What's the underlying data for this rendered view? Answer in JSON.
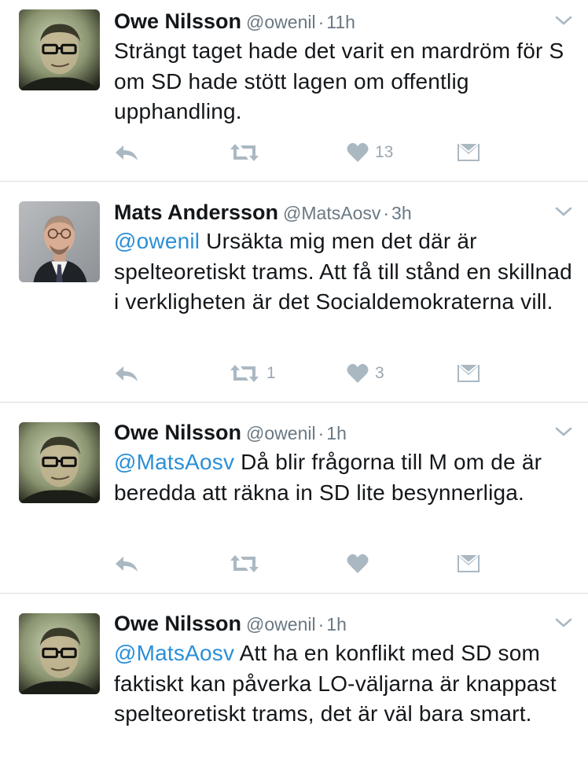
{
  "tweets": [
    {
      "name": "Owe Nilsson",
      "handle": "@owenil",
      "separator": "·",
      "time": "11h",
      "mention": "",
      "text": "Strängt taget hade det varit en mardröm för S om SD hade stött lagen om offentlig upphandling.",
      "retweets": "",
      "likes": "13",
      "avatar": "owe-nilsson-photo"
    },
    {
      "name": "Mats Andersson",
      "handle": "@MatsAosv",
      "separator": "·",
      "time": "3h",
      "mention": "@owenil",
      "text": " Ursäkta mig men det där är spelteoretiskt trams. Att få till stånd en skillnad i verkligheten är det Socialdemokraterna vill.",
      "retweets": "1",
      "likes": "3",
      "avatar": "mats-andersson-photo"
    },
    {
      "name": "Owe Nilsson",
      "handle": "@owenil",
      "separator": "·",
      "time": "1h",
      "mention": "@MatsAosv",
      "text": " Då blir frågorna till M om de är beredda att räkna in SD lite besynnerliga.",
      "retweets": "",
      "likes": "",
      "avatar": "owe-nilsson-photo"
    },
    {
      "name": "Owe Nilsson",
      "handle": "@owenil",
      "separator": "·",
      "time": "1h",
      "mention": "@MatsAosv",
      "text": " Att ha en konflikt med SD som faktiskt kan påverka LO-väljarna är knappast spelteoretiskt trams, det är väl bara smart.",
      "retweets": "",
      "likes": "",
      "avatar": "owe-nilsson-photo"
    }
  ],
  "colors": {
    "name": "#14171a",
    "meta": "#697883",
    "mention": "#2b8fd6",
    "action_icon": "#aab8c2",
    "divider": "#d8dde2"
  },
  "icons": [
    "reply-icon",
    "retweet-icon",
    "heart-icon",
    "direct-message-icon",
    "chevron-down-icon"
  ]
}
